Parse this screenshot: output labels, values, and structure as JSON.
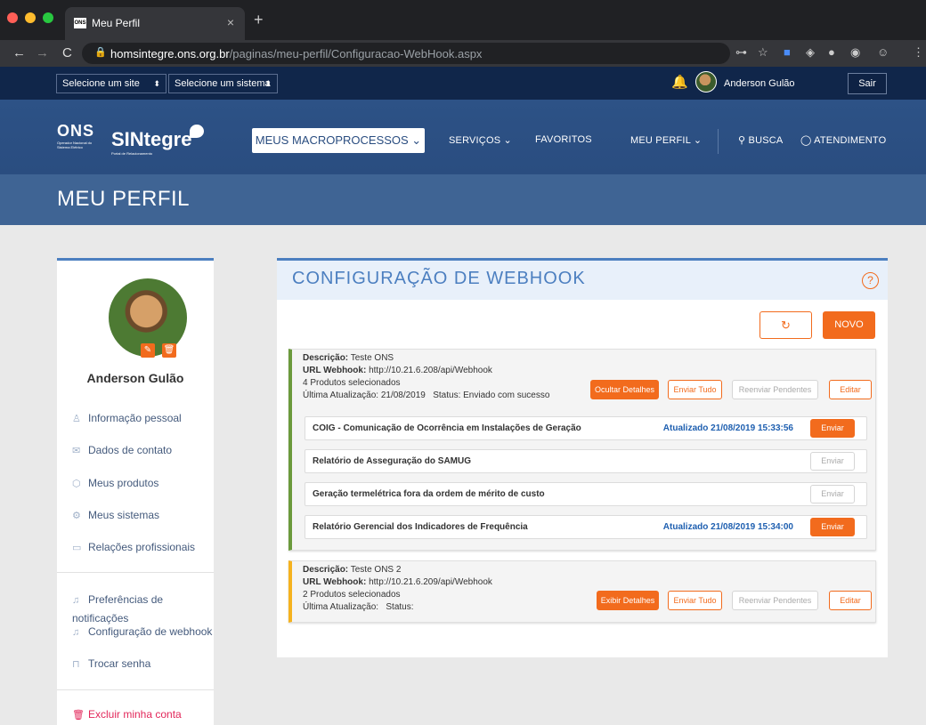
{
  "browser": {
    "tab_title": "Meu Perfil",
    "tab_favicon": "ONS",
    "url_domain": "homsintegre.ons.org.br",
    "url_path": "/paginas/meu-perfil/Configuracao-WebHook.aspx"
  },
  "topbar": {
    "site_select": "Selecione um site",
    "system_select": "Selecione um sistema",
    "user_name": "Anderson Gulão",
    "logout_label": "Sair"
  },
  "nav": {
    "logo_ons": "ONS",
    "logo_ons_sub": "Operador Nacional do Sistema Elétrico",
    "logo_sintegre": "SINtegre",
    "logo_sintegre_sub": "Portal de Relacionamento",
    "macro_label": "MEUS MACROPROCESSOS ⌄",
    "servicos": "SERVIÇOS ⌄",
    "favoritos": "FAVORITOS",
    "meu_perfil": "MEU PERFIL ⌄",
    "busca": "BUSCA",
    "atendimento": "ATENDIMENTO"
  },
  "page_title": "MEU PERFIL",
  "sidebar": {
    "name": "Anderson Gulão",
    "items": [
      {
        "label": "Informação pessoal"
      },
      {
        "label": "Dados de contato"
      },
      {
        "label": "Meus produtos"
      },
      {
        "label": "Meus sistemas"
      },
      {
        "label": "Relações profissionais"
      },
      {
        "label": "Preferências de notificações"
      },
      {
        "label": "Configuração de webhook"
      },
      {
        "label": "Trocar senha"
      },
      {
        "label": "Excluir minha conta"
      }
    ]
  },
  "panel": {
    "title": "CONFIGURAÇÃO DE WEBHOOK",
    "novo_label": "NOVO"
  },
  "webhooks": [
    {
      "descricao_label": "Descrição:",
      "descricao": "Teste ONS",
      "url_label": "URL Webhook:",
      "url": "http://10.21.6.208/api/Webhook",
      "produtos": "4 Produtos selecionados",
      "ultima": "Última Atualização: 21/08/2019",
      "status": "Status: Enviado com sucesso",
      "toggle_label": "Ocultar Detalhes",
      "enviar_tudo": "Enviar Tudo",
      "reenviar": "Reenviar Pendentes",
      "editar": "Editar",
      "products": [
        {
          "name": "COIG - Comunicação de Ocorrência em Instalações de Geração",
          "updated": "Atualizado 21/08/2019 15:33:56",
          "btn": "Enviar"
        },
        {
          "name": "Relatório de Asseguração do SAMUG",
          "updated": "",
          "btn": "Enviar"
        },
        {
          "name": "Geração termelétrica fora da ordem de mérito de custo",
          "updated": "",
          "btn": "Enviar"
        },
        {
          "name": "Relatório Gerencial dos Indicadores de Frequência",
          "updated": "Atualizado 21/08/2019 15:34:00",
          "btn": "Enviar"
        }
      ]
    },
    {
      "descricao_label": "Descrição:",
      "descricao": "Teste ONS 2",
      "url_label": "URL Webhook:",
      "url": "http://10.21.6.209/api/Webhook",
      "produtos": "2 Produtos selecionados",
      "ultima": "Última Atualização:",
      "status": "Status:",
      "toggle_label": "Exibir Detalhes",
      "enviar_tudo": "Enviar Tudo",
      "reenviar": "Reenviar Pendentes",
      "editar": "Editar"
    }
  ],
  "colors": {
    "accent_orange": "#f26b1d",
    "nav_blue": "#2a4d80",
    "topbar_navy": "#10264a",
    "status_green": "#6b9a3c",
    "status_yellow": "#f5b21f",
    "link_blue": "#1e5fb0"
  }
}
